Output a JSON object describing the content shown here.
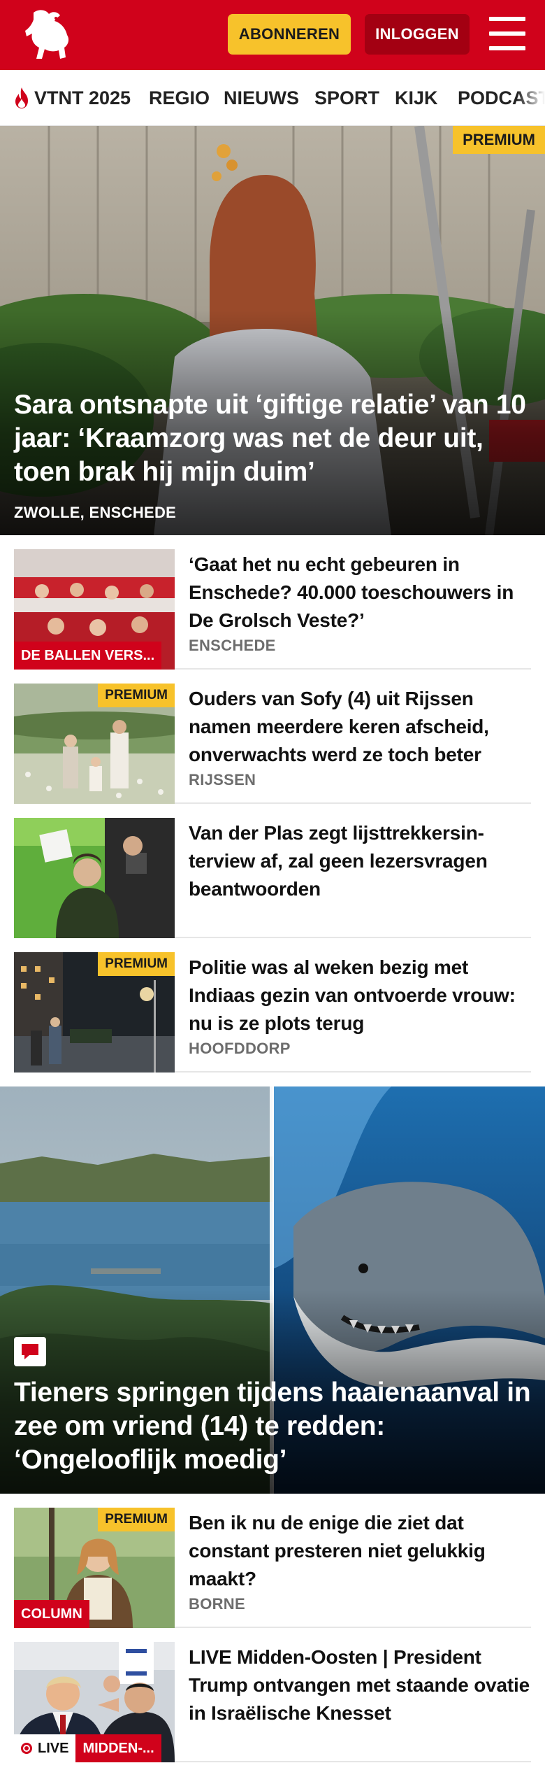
{
  "header": {
    "subscribe_label": "ABONNEREN",
    "login_label": "INLOGGEN",
    "brand_color": "#d0021b",
    "accent_color": "#f7c22b"
  },
  "nav": {
    "items": [
      {
        "label": "VTNT 2025",
        "icon": "flame-icon"
      },
      {
        "label": "REGIO"
      },
      {
        "label": "NIEUWS"
      },
      {
        "label": "SPORT"
      },
      {
        "label": "KIJK"
      },
      {
        "label": "PODCAST"
      }
    ]
  },
  "hero": {
    "badge": "PREMIUM",
    "title": "Sara ontsnapte uit ‘giftige relatie’ van 10 jaar: ‘Kraamzorg was net de deur uit, toen brak hij mijn duim’",
    "location": "ZWOLLE, ENSCHEDE"
  },
  "articles": [
    {
      "title": "‘Gaat het nu echt gebeuren in Enschede? 40.000 toeschouwers in De Grolsch Veste?’",
      "location": "ENSCHEDE",
      "label": "DE BALLEN VERS..."
    },
    {
      "title": "Ouders van Sofy (4) uit Rijssen namen meerdere keren afscheid, onverwachts werd ze toch beter",
      "location": "RIJSSEN",
      "badge": "PREMIUM"
    },
    {
      "title": "Van der Plas zegt lijsttrekkersin­terview af, zal geen lezersvragen beantwoorden"
    },
    {
      "title": "Politie was al weken bezig met Indiaas gezin van ontvoerde vrouw: nu is ze plots terug",
      "location": "HOOFDDORP",
      "badge": "PREMIUM"
    }
  ],
  "feature": {
    "title": "Tieners springen tijdens haaienaanval in zee om vriend (14) te redden: ‘Ongelooflijk moedig’",
    "icon": "comment-icon"
  },
  "articles_2": [
    {
      "title": "Ben ik nu de enige die ziet dat constant presteren niet gelukkig maakt?",
      "location": "BORNE",
      "badge": "PREMIUM",
      "label": "COLUMN"
    },
    {
      "title": "LIVE Midden-Oosten | President Trump ontvangen met staande ovatie in Israëlische Knesset",
      "live_label": "LIVE",
      "label": "MIDDEN-..."
    }
  ]
}
